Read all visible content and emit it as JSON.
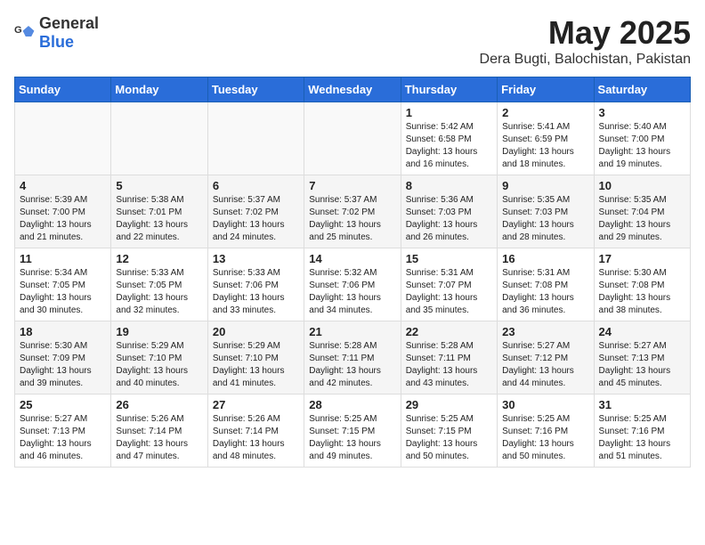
{
  "logo": {
    "general": "General",
    "blue": "Blue"
  },
  "title": "May 2025",
  "subtitle": "Dera Bugti, Balochistan, Pakistan",
  "days_of_week": [
    "Sunday",
    "Monday",
    "Tuesday",
    "Wednesday",
    "Thursday",
    "Friday",
    "Saturday"
  ],
  "weeks": [
    [
      {
        "day": "",
        "detail": ""
      },
      {
        "day": "",
        "detail": ""
      },
      {
        "day": "",
        "detail": ""
      },
      {
        "day": "",
        "detail": ""
      },
      {
        "day": "1",
        "detail": "Sunrise: 5:42 AM\nSunset: 6:58 PM\nDaylight: 13 hours\nand 16 minutes."
      },
      {
        "day": "2",
        "detail": "Sunrise: 5:41 AM\nSunset: 6:59 PM\nDaylight: 13 hours\nand 18 minutes."
      },
      {
        "day": "3",
        "detail": "Sunrise: 5:40 AM\nSunset: 7:00 PM\nDaylight: 13 hours\nand 19 minutes."
      }
    ],
    [
      {
        "day": "4",
        "detail": "Sunrise: 5:39 AM\nSunset: 7:00 PM\nDaylight: 13 hours\nand 21 minutes."
      },
      {
        "day": "5",
        "detail": "Sunrise: 5:38 AM\nSunset: 7:01 PM\nDaylight: 13 hours\nand 22 minutes."
      },
      {
        "day": "6",
        "detail": "Sunrise: 5:37 AM\nSunset: 7:02 PM\nDaylight: 13 hours\nand 24 minutes."
      },
      {
        "day": "7",
        "detail": "Sunrise: 5:37 AM\nSunset: 7:02 PM\nDaylight: 13 hours\nand 25 minutes."
      },
      {
        "day": "8",
        "detail": "Sunrise: 5:36 AM\nSunset: 7:03 PM\nDaylight: 13 hours\nand 26 minutes."
      },
      {
        "day": "9",
        "detail": "Sunrise: 5:35 AM\nSunset: 7:03 PM\nDaylight: 13 hours\nand 28 minutes."
      },
      {
        "day": "10",
        "detail": "Sunrise: 5:35 AM\nSunset: 7:04 PM\nDaylight: 13 hours\nand 29 minutes."
      }
    ],
    [
      {
        "day": "11",
        "detail": "Sunrise: 5:34 AM\nSunset: 7:05 PM\nDaylight: 13 hours\nand 30 minutes."
      },
      {
        "day": "12",
        "detail": "Sunrise: 5:33 AM\nSunset: 7:05 PM\nDaylight: 13 hours\nand 32 minutes."
      },
      {
        "day": "13",
        "detail": "Sunrise: 5:33 AM\nSunset: 7:06 PM\nDaylight: 13 hours\nand 33 minutes."
      },
      {
        "day": "14",
        "detail": "Sunrise: 5:32 AM\nSunset: 7:06 PM\nDaylight: 13 hours\nand 34 minutes."
      },
      {
        "day": "15",
        "detail": "Sunrise: 5:31 AM\nSunset: 7:07 PM\nDaylight: 13 hours\nand 35 minutes."
      },
      {
        "day": "16",
        "detail": "Sunrise: 5:31 AM\nSunset: 7:08 PM\nDaylight: 13 hours\nand 36 minutes."
      },
      {
        "day": "17",
        "detail": "Sunrise: 5:30 AM\nSunset: 7:08 PM\nDaylight: 13 hours\nand 38 minutes."
      }
    ],
    [
      {
        "day": "18",
        "detail": "Sunrise: 5:30 AM\nSunset: 7:09 PM\nDaylight: 13 hours\nand 39 minutes."
      },
      {
        "day": "19",
        "detail": "Sunrise: 5:29 AM\nSunset: 7:10 PM\nDaylight: 13 hours\nand 40 minutes."
      },
      {
        "day": "20",
        "detail": "Sunrise: 5:29 AM\nSunset: 7:10 PM\nDaylight: 13 hours\nand 41 minutes."
      },
      {
        "day": "21",
        "detail": "Sunrise: 5:28 AM\nSunset: 7:11 PM\nDaylight: 13 hours\nand 42 minutes."
      },
      {
        "day": "22",
        "detail": "Sunrise: 5:28 AM\nSunset: 7:11 PM\nDaylight: 13 hours\nand 43 minutes."
      },
      {
        "day": "23",
        "detail": "Sunrise: 5:27 AM\nSunset: 7:12 PM\nDaylight: 13 hours\nand 44 minutes."
      },
      {
        "day": "24",
        "detail": "Sunrise: 5:27 AM\nSunset: 7:13 PM\nDaylight: 13 hours\nand 45 minutes."
      }
    ],
    [
      {
        "day": "25",
        "detail": "Sunrise: 5:27 AM\nSunset: 7:13 PM\nDaylight: 13 hours\nand 46 minutes."
      },
      {
        "day": "26",
        "detail": "Sunrise: 5:26 AM\nSunset: 7:14 PM\nDaylight: 13 hours\nand 47 minutes."
      },
      {
        "day": "27",
        "detail": "Sunrise: 5:26 AM\nSunset: 7:14 PM\nDaylight: 13 hours\nand 48 minutes."
      },
      {
        "day": "28",
        "detail": "Sunrise: 5:25 AM\nSunset: 7:15 PM\nDaylight: 13 hours\nand 49 minutes."
      },
      {
        "day": "29",
        "detail": "Sunrise: 5:25 AM\nSunset: 7:15 PM\nDaylight: 13 hours\nand 50 minutes."
      },
      {
        "day": "30",
        "detail": "Sunrise: 5:25 AM\nSunset: 7:16 PM\nDaylight: 13 hours\nand 50 minutes."
      },
      {
        "day": "31",
        "detail": "Sunrise: 5:25 AM\nSunset: 7:16 PM\nDaylight: 13 hours\nand 51 minutes."
      }
    ]
  ]
}
